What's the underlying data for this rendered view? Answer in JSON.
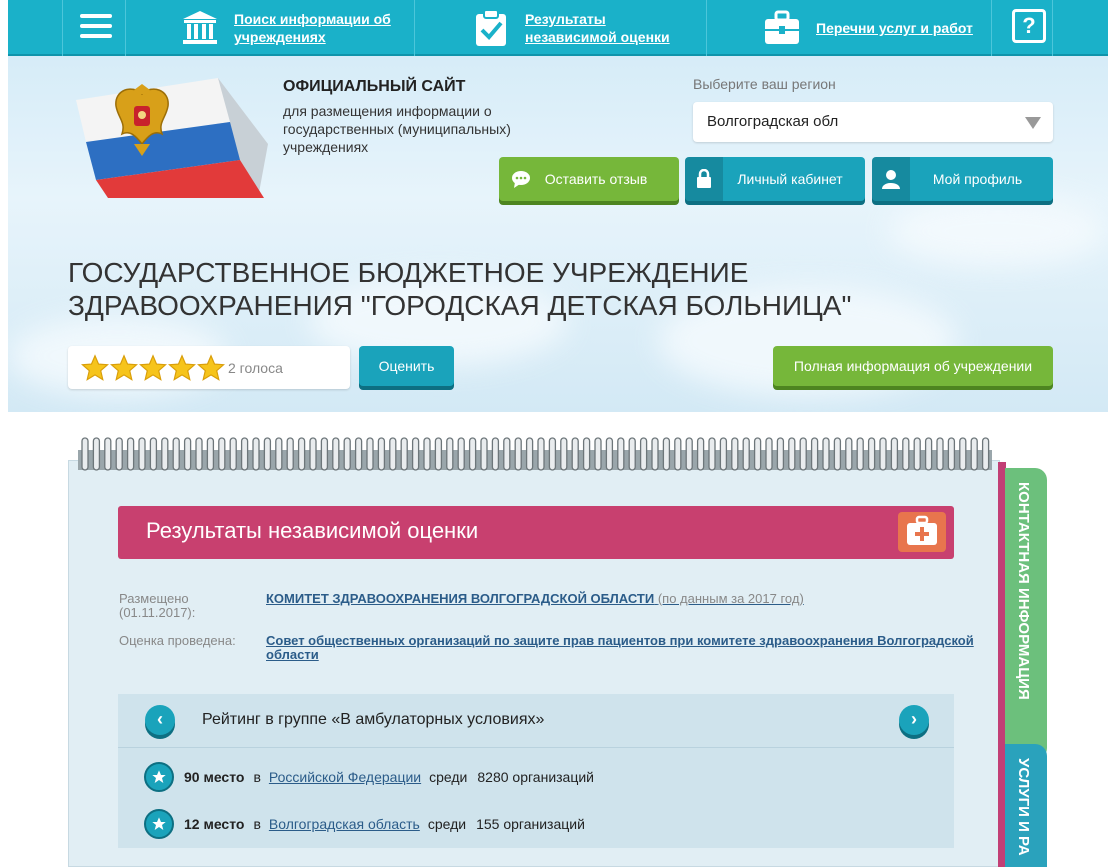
{
  "nav": {
    "search_label": "Поиск информации об учреждениях",
    "results_label": "Результаты независимой оценки",
    "lists_label": "Перечни услуг и работ",
    "help_label": "?"
  },
  "header": {
    "site_title": "ОФИЦИАЛЬНЫЙ САЙТ",
    "site_subtitle": "для размещения информации о государственных (муниципальных) учреждениях",
    "region_label": "Выберите ваш регион",
    "region_value": "Волгоградская обл",
    "feedback_button": "Оставить отзыв",
    "cabinet_button": "Личный кабинет",
    "profile_button": "Мой профиль"
  },
  "institution": {
    "name": "ГОСУДАРСТВЕННОЕ БЮДЖЕТНОЕ УЧРЕЖДЕНИЕ ЗДРАВООХРАНЕНИЯ \"ГОРОДСКАЯ ДЕТСКАЯ БОЛЬНИЦА\"",
    "stars": 5,
    "votes": "2 голоса",
    "rate_button": "Оценить",
    "full_info_button": "Полная информация об учреждении"
  },
  "side_tabs": {
    "contact": "КОНТАКТНАЯ ИНФОРМАЦИЯ",
    "services": "УСЛУГИ И РА"
  },
  "results": {
    "title": "Результаты независимой оценки",
    "posted_label": "Размещено (01.11.2017):",
    "posted_by": "КОМИТЕТ ЗДРАВООХРАНЕНИЯ ВОЛГОГРАДСКОЙ ОБЛАСТИ",
    "posted_note": "(по данным за 2017 год)",
    "conducted_label": "Оценка проведена:",
    "conducted_by": "Совет общественных организаций по защите прав пациентов при комитете здравоохранения Волгоградской области",
    "group_title": "Рейтинг в группе «В амбулаторных условиях»",
    "prev": "‹",
    "next": "›",
    "rankings": [
      {
        "place": "90 место",
        "in": "в",
        "area": "Российской Федерации",
        "among": "среди",
        "count": "8280 организаций"
      },
      {
        "place": "12 место",
        "in": "в",
        "area": "Волгоградская область",
        "among": "среди",
        "count": "155 организаций"
      }
    ]
  }
}
